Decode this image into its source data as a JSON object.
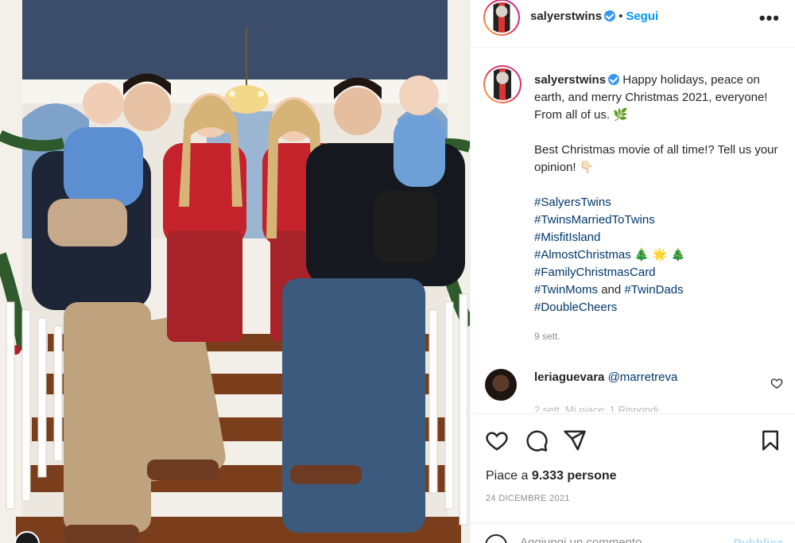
{
  "post": {
    "username": "salyerstwins",
    "follow_label": "Segui",
    "dot": "•",
    "more": "•••"
  },
  "caption": {
    "username": "salyerstwins",
    "line1": "Happy holidays, peace on earth, and merry Christmas 2021, everyone! From all of us. 🌿",
    "line2": "Best Christmas movie of all time!? Tell us your opinion! 👇🏻",
    "hashtags": {
      "h1": "#SalyersTwins",
      "h2": "#TwinsMarriedToTwins",
      "h3": "#MisfitIsland",
      "h4": "#AlmostChristmas",
      "h4_emoji": "🎄 🌟 🎄",
      "h5": "#FamilyChristmasCard",
      "h6a": "#TwinMoms",
      "h6_and": "and",
      "h6b": "#TwinDads",
      "h7": "#DoubleCheers"
    },
    "time_ago": "9 sett."
  },
  "comment": {
    "username": "leriaguevara",
    "mention": "@marretreva",
    "faded": "2 sett.   Mi piace: 1   Rispondi"
  },
  "actions": {
    "like_icon": "heart-icon",
    "comment_icon": "comment-icon",
    "share_icon": "share-icon",
    "save_icon": "bookmark-icon",
    "likes_prefix": "Piace a",
    "likes_count": "9.333 persone",
    "date": "24 DICEMBRE 2021"
  },
  "add_comment": {
    "placeholder": "Aggiungi un commento...",
    "publish_label": "Pubblica"
  },
  "colors": {
    "link": "#00376b",
    "accent": "#0095f6",
    "muted": "#8e8e8e"
  }
}
